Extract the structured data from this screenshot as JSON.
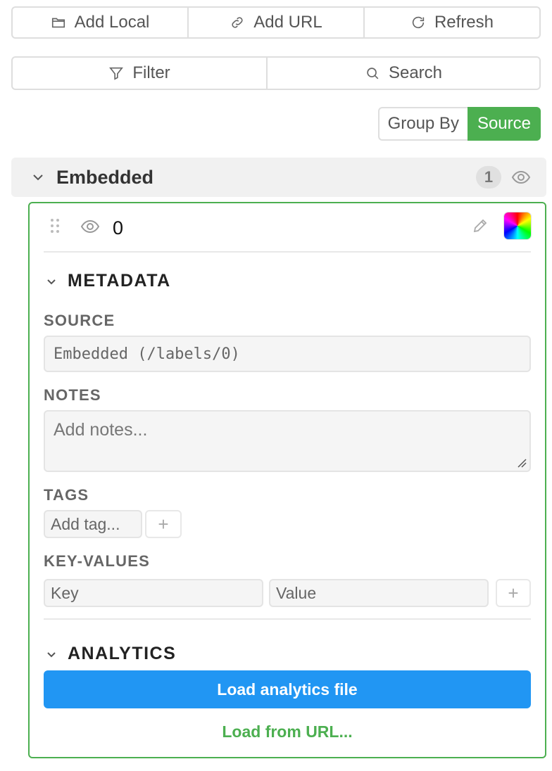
{
  "toolbar": {
    "add_local": "Add Local",
    "add_url": "Add URL",
    "refresh": "Refresh",
    "filter": "Filter",
    "search": "Search"
  },
  "group_by": {
    "label": "Group By",
    "value": "Source"
  },
  "group": {
    "title": "Embedded",
    "count": "1"
  },
  "item": {
    "name": "0",
    "color": "rainbow"
  },
  "metadata": {
    "heading": "METADATA",
    "source_label": "SOURCE",
    "source_value": "Embedded (/labels/0)",
    "notes_label": "NOTES",
    "notes_placeholder": "Add notes...",
    "tags_label": "TAGS",
    "tag_placeholder": "Add tag...",
    "kv_label": "KEY-VALUES",
    "key_placeholder": "Key",
    "value_placeholder": "Value",
    "plus": "+"
  },
  "analytics": {
    "heading": "ANALYTICS",
    "load_file": "Load analytics file",
    "load_url": "Load from URL..."
  },
  "colors": {
    "accent_green": "#4caf50",
    "primary_blue": "#2196f3"
  }
}
